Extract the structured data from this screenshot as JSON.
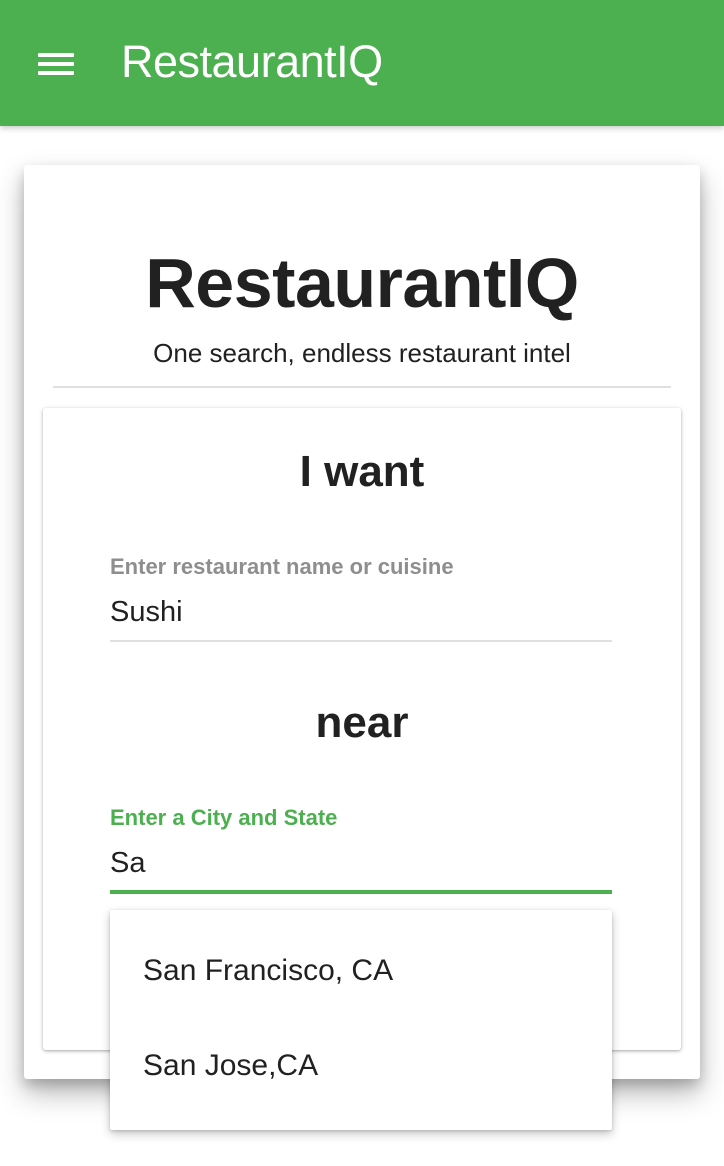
{
  "app_bar": {
    "title": "RestaurantIQ",
    "color": "#4caf50",
    "menu_icon": "hamburger-menu-icon"
  },
  "hero": {
    "title": "RestaurantIQ",
    "subtitle": "One search, endless restaurant intel"
  },
  "search": {
    "want_heading": "I want",
    "cuisine_label": "Enter restaurant name or cuisine",
    "cuisine_value": "Sushi",
    "near_heading": "near",
    "location_label": "Enter a City and State",
    "location_value": "Sa",
    "focus_color": "#4caf50"
  },
  "suggestions": [
    "San Francisco, CA",
    "San Jose,CA"
  ]
}
